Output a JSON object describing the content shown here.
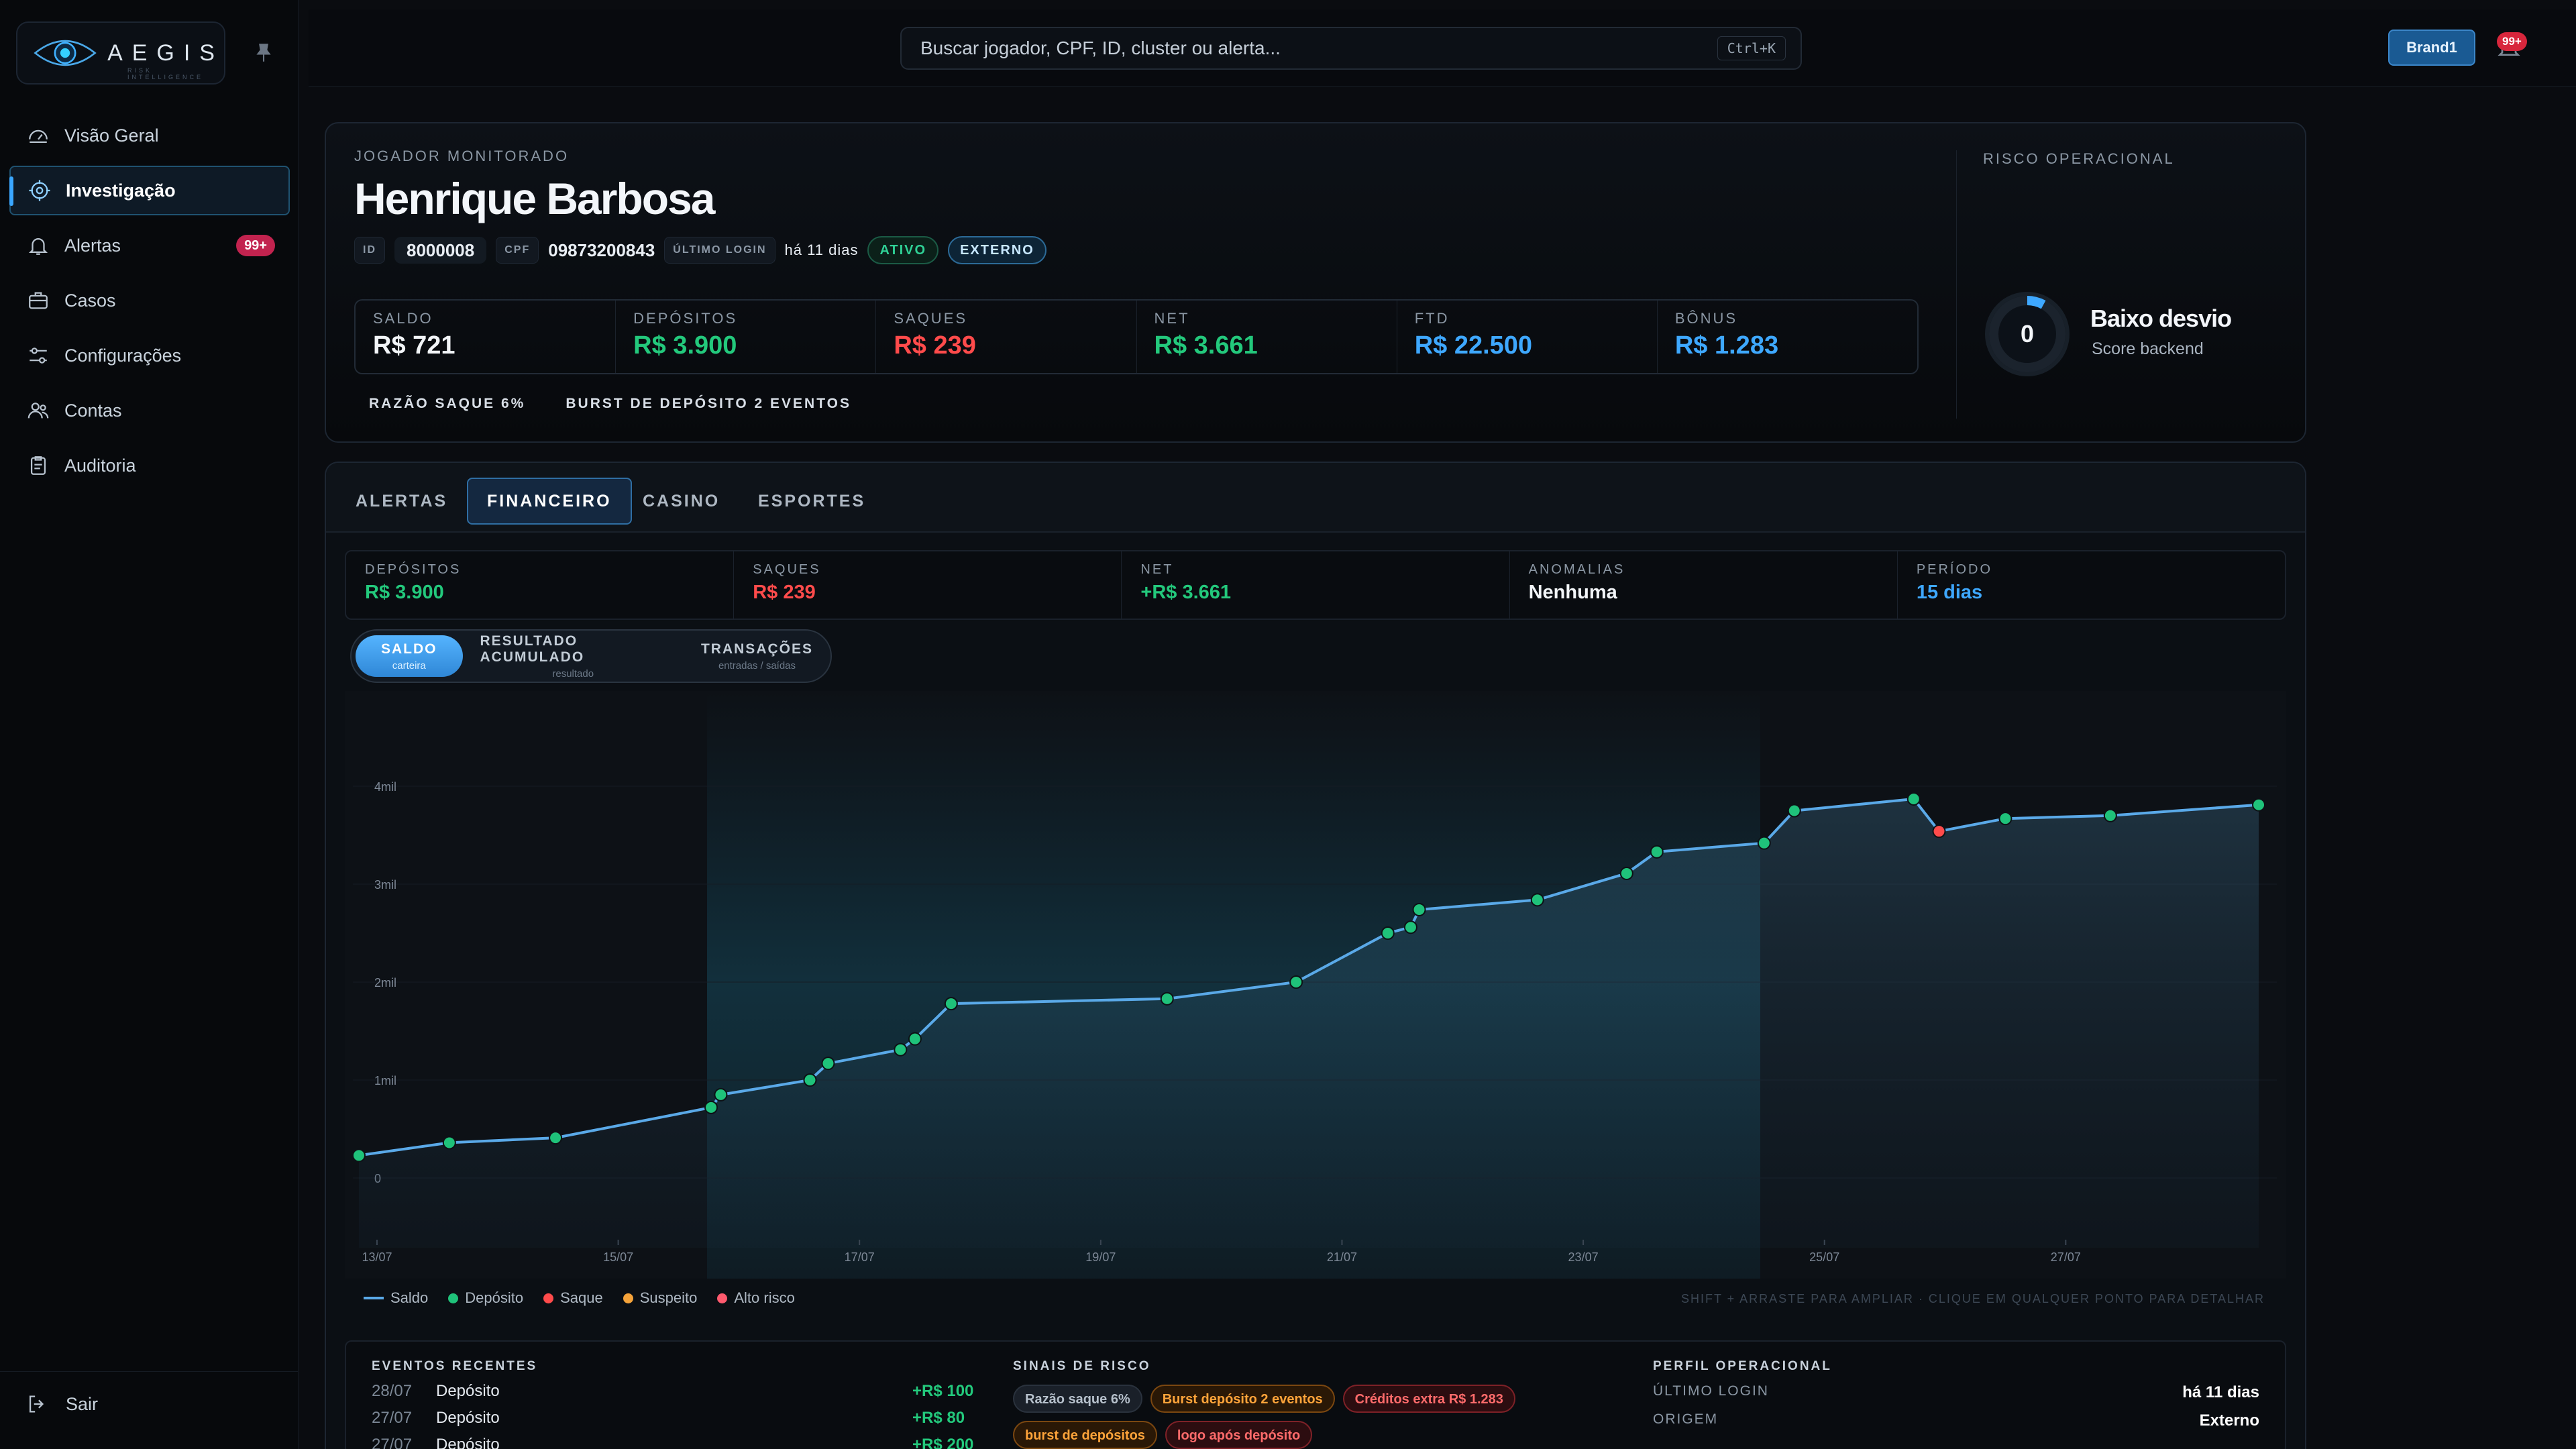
{
  "brand": {
    "name": "AEGIS",
    "tagline": "RISK INTELLIGENCE"
  },
  "sidebar": {
    "items": [
      {
        "label": "Visão Geral",
        "icon": "dashboard-icon"
      },
      {
        "label": "Investigação",
        "icon": "target-icon",
        "active": true
      },
      {
        "label": "Alertas",
        "icon": "bell-icon",
        "badge": "99+"
      },
      {
        "label": "Casos",
        "icon": "briefcase-icon"
      },
      {
        "label": "Configurações",
        "icon": "sliders-icon"
      },
      {
        "label": "Contas",
        "icon": "users-icon"
      },
      {
        "label": "Auditoria",
        "icon": "clipboard-icon"
      }
    ],
    "logout": "Sair"
  },
  "topbar": {
    "search_placeholder": "Buscar jogador, CPF, ID, cluster ou alerta...",
    "shortcut": "Ctrl+K",
    "brand_button": "Brand1",
    "notifications_badge": "99+"
  },
  "player": {
    "section_label": "JOGADOR MONITORADO",
    "name": "Henrique Barbosa",
    "id_label": "ID",
    "id": "8000008",
    "cpf_label": "CPF",
    "cpf": "09873200843",
    "last_login_label": "ÚLTIMO LOGIN",
    "last_login": "há 11 dias",
    "status": "ATIVO",
    "origin": "EXTERNO",
    "stats": [
      {
        "label": "SALDO",
        "value": "R$ 721",
        "color": "white"
      },
      {
        "label": "DEPÓSITOS",
        "value": "R$ 3.900",
        "color": "green"
      },
      {
        "label": "SAQUES",
        "value": "R$ 239",
        "color": "red"
      },
      {
        "label": "NET",
        "value": "R$ 3.661",
        "color": "green"
      },
      {
        "label": "FTD",
        "value": "R$ 22.500",
        "color": "blue"
      },
      {
        "label": "BÔNUS",
        "value": "R$ 1.283",
        "color": "blue"
      }
    ],
    "flags": [
      "RAZÃO SAQUE 6%",
      "BURST DE DEPÓSITO 2 EVENTOS"
    ]
  },
  "risk": {
    "label": "RISCO OPERACIONAL",
    "score": "0",
    "score_fraction": 0.08,
    "title": "Baixo desvio",
    "subtitle": "Score backend"
  },
  "tabs": [
    "ALERTAS",
    "FINANCEIRO",
    "CASINO",
    "ESPORTES"
  ],
  "active_tab": "FINANCEIRO",
  "summary": [
    {
      "label": "DEPÓSITOS",
      "value": "R$ 3.900",
      "color": "green"
    },
    {
      "label": "SAQUES",
      "value": "R$ 239",
      "color": "red"
    },
    {
      "label": "NET",
      "value": "+R$ 3.661",
      "color": "green"
    },
    {
      "label": "ANOMALIAS",
      "value": "Nenhuma",
      "color": "white"
    },
    {
      "label": "PERÍODO",
      "value": "15 dias",
      "color": "blue"
    }
  ],
  "modes": [
    {
      "title": "SALDO",
      "sub": "carteira",
      "active": true
    },
    {
      "title": "RESULTADO ACUMULADO",
      "sub": "resultado"
    },
    {
      "title": "TRANSAÇÕES",
      "sub": "entradas / saídas"
    }
  ],
  "chart_data": {
    "type": "line",
    "series": [
      {
        "name": "Saldo"
      }
    ],
    "x_ticks": [
      "13/07",
      "15/07",
      "17/07",
      "19/07",
      "21/07",
      "23/07",
      "25/07",
      "27/07"
    ],
    "y_ticks": [
      "0",
      "1mil",
      "2mil",
      "3mil",
      "4mil"
    ],
    "ylim": [
      0,
      4000
    ],
    "xlim_days": [
      12.8,
      28.75
    ],
    "points": [
      {
        "x": 12.85,
        "y": 230,
        "kind": "deposito"
      },
      {
        "x": 13.6,
        "y": 360,
        "kind": "deposito"
      },
      {
        "x": 14.48,
        "y": 410,
        "kind": "deposito"
      },
      {
        "x": 15.77,
        "y": 720,
        "kind": "deposito"
      },
      {
        "x": 15.85,
        "y": 850,
        "kind": "deposito"
      },
      {
        "x": 16.59,
        "y": 1000,
        "kind": "deposito"
      },
      {
        "x": 16.74,
        "y": 1170,
        "kind": "deposito"
      },
      {
        "x": 17.34,
        "y": 1310,
        "kind": "deposito"
      },
      {
        "x": 17.46,
        "y": 1420,
        "kind": "deposito"
      },
      {
        "x": 17.76,
        "y": 1780,
        "kind": "deposito"
      },
      {
        "x": 19.55,
        "y": 1830,
        "kind": "deposito"
      },
      {
        "x": 20.62,
        "y": 2000,
        "kind": "deposito"
      },
      {
        "x": 21.38,
        "y": 2500,
        "kind": "deposito"
      },
      {
        "x": 21.57,
        "y": 2560,
        "kind": "deposito"
      },
      {
        "x": 21.64,
        "y": 2740,
        "kind": "deposito"
      },
      {
        "x": 22.62,
        "y": 2840,
        "kind": "deposito"
      },
      {
        "x": 23.36,
        "y": 3110,
        "kind": "deposito"
      },
      {
        "x": 23.61,
        "y": 3330,
        "kind": "deposito"
      },
      {
        "x": 24.5,
        "y": 3420,
        "kind": "deposito"
      },
      {
        "x": 24.75,
        "y": 3750,
        "kind": "deposito"
      },
      {
        "x": 25.74,
        "y": 3870,
        "kind": "deposito"
      },
      {
        "x": 25.95,
        "y": 3540,
        "kind": "saque"
      },
      {
        "x": 26.5,
        "y": 3670,
        "kind": "deposito"
      },
      {
        "x": 27.37,
        "y": 3700,
        "kind": "deposito"
      },
      {
        "x": 28.6,
        "y": 3810,
        "kind": "deposito"
      }
    ],
    "legend": [
      "Saldo",
      "Depósito",
      "Saque",
      "Suspeito",
      "Alto risco"
    ],
    "colors": {
      "line": "#5aa9e8",
      "deposito": "#1fc27a",
      "saque": "#ff4b4b",
      "suspeito": "#f5a33a",
      "alto_risco": "#ff5a6e"
    },
    "hint": "SHIFT + ARRASTE PARA AMPLIAR · CLIQUE EM QUALQUER PONTO PARA DETALHAR"
  },
  "events": {
    "title": "EVENTOS RECENTES",
    "rows": [
      {
        "date": "28/07",
        "name": "Depósito",
        "amount": "+R$ 100"
      },
      {
        "date": "27/07",
        "name": "Depósito",
        "amount": "+R$ 80"
      },
      {
        "date": "27/07",
        "name": "Depósito",
        "amount": "+R$ 200"
      }
    ]
  },
  "signals": {
    "title": "SINAIS DE RISCO",
    "chips": [
      {
        "label": "Razão saque 6%",
        "tone": "gray"
      },
      {
        "label": "Burst depósito 2 eventos",
        "tone": "orange"
      },
      {
        "label": "Créditos extra R$ 1.283",
        "tone": "red"
      },
      {
        "label": "burst de depósitos",
        "tone": "orange"
      },
      {
        "label": "logo após depósito",
        "tone": "red"
      }
    ]
  },
  "profile": {
    "title": "PERFIL OPERACIONAL",
    "rows": [
      {
        "key": "ÚLTIMO LOGIN",
        "value": "há 11 dias"
      },
      {
        "key": "ORIGEM",
        "value": "Externo"
      }
    ]
  }
}
